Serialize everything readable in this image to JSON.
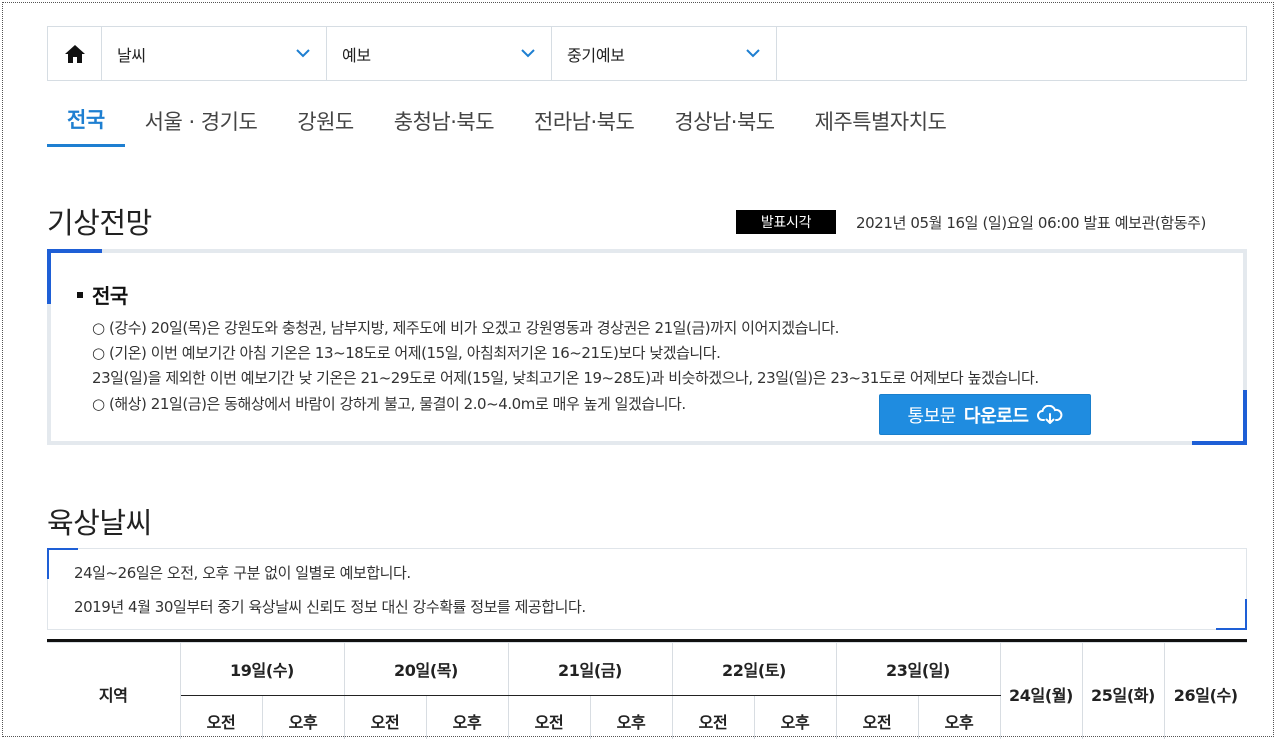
{
  "breadcrumb": {
    "home_icon": "home-icon",
    "selects": [
      {
        "label": "날씨"
      },
      {
        "label": "예보"
      },
      {
        "label": "중기예보"
      }
    ]
  },
  "tabs": [
    {
      "label": "전국",
      "active": true
    },
    {
      "label": "서울 · 경기도"
    },
    {
      "label": "강원도"
    },
    {
      "label": "충청남·북도"
    },
    {
      "label": "전라남·북도"
    },
    {
      "label": "경상남·북도"
    },
    {
      "label": "제주특별자치도"
    }
  ],
  "forecast": {
    "title": "기상전망",
    "badge": "발표시각",
    "publish_time": "2021년 05월 16일 (일)요일 06:00 발표 예보관(함동주)",
    "region_title": "전국",
    "lines": [
      "○ (강수) 20일(목)은 강원도와 충청권, 남부지방, 제주도에 비가 오겠고 강원영동과 경상권은 21일(금)까지 이어지겠습니다.",
      "○ (기온) 이번 예보기간 아침 기온은 13~18도로 어제(15일, 아침최저기온 16~21도)보다 낮겠습니다.",
      "23일(일)을 제외한 이번 예보기간 낮 기온은 21~29도로 어제(15일, 낮최고기온 19~28도)과 비슷하겠으나, 23일(일)은 23~31도로 어제보다 높겠습니다.",
      "○ (해상) 21일(금)은 동해상에서 바람이 강하게 불고, 물결이 2.0~4.0m로 매우 높게 일겠습니다."
    ],
    "download": {
      "prefix": "통보문",
      "bold": "다운로드",
      "icon": "cloud-download-icon"
    }
  },
  "land": {
    "title": "육상날씨",
    "notes": [
      "24일~26일은 오전, 오후 구분 없이 일별로 예보합니다.",
      "2019년 4월 30일부터 중기 육상날씨 신뢰도 정보 대신 강수확률 정보를 제공합니다."
    ],
    "table": {
      "region_header": "지역",
      "split_days": [
        "19일(수)",
        "20일(목)",
        "21일(금)",
        "22일(토)",
        "23일(일)"
      ],
      "whole_days": [
        "24일(월)",
        "25일(화)",
        "26일(수)"
      ],
      "am": "오전",
      "pm": "오후"
    }
  },
  "colors": {
    "accent": "#1e7fd1",
    "corner": "#1e5fd6",
    "button": "#1f8ce0"
  }
}
